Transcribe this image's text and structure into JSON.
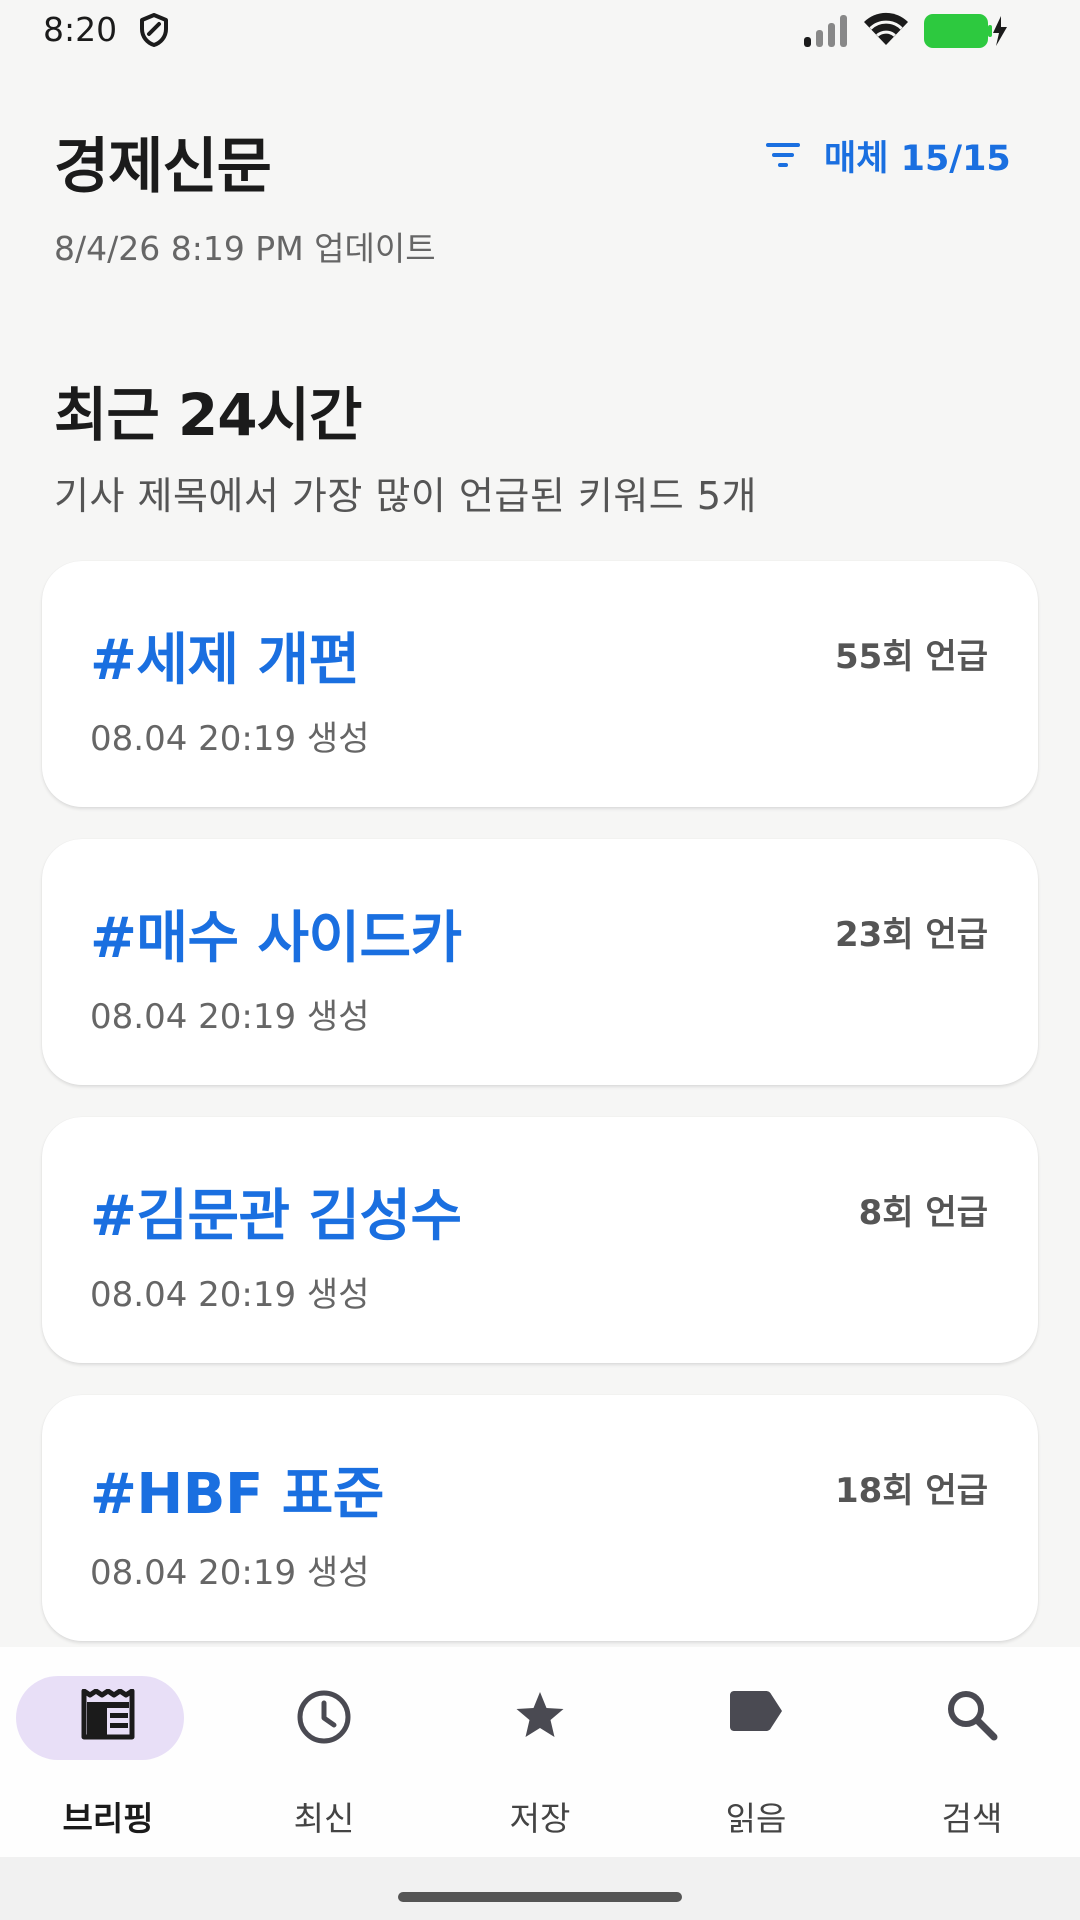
{
  "status": {
    "time": "8:20"
  },
  "header": {
    "title": "경제신문",
    "filter_label": "매체 15/15",
    "updated": "8/4/26 8:19 PM 업데이트"
  },
  "section": {
    "title": "최근 24시간",
    "description": "기사 제목에서 가장 많이 언급된 키워드 5개"
  },
  "cards": [
    {
      "keyword": "#세제 개편",
      "count": "55회 언급",
      "created": "08.04 20:19 생성"
    },
    {
      "keyword": "#매수 사이드카",
      "count": "23회 언급",
      "created": "08.04 20:19 생성"
    },
    {
      "keyword": "#김문관 김성수",
      "count": "8회 언급",
      "created": "08.04 20:19 생성"
    },
    {
      "keyword": "#HBF 표준",
      "count": "18회 언급",
      "created": "08.04 20:19 생성"
    }
  ],
  "nav": {
    "items": [
      {
        "label": "브리핑",
        "icon": "briefing-icon",
        "active": true
      },
      {
        "label": "최신",
        "icon": "clock-icon",
        "active": false
      },
      {
        "label": "저장",
        "icon": "star-icon",
        "active": false
      },
      {
        "label": "읽음",
        "icon": "label-icon",
        "active": false
      },
      {
        "label": "검색",
        "icon": "search-icon",
        "active": false
      }
    ]
  },
  "colors": {
    "accent": "#1a6fe0",
    "active_pill": "#e8dff7",
    "battery": "#2dc93f",
    "background": "#f6f6f5"
  }
}
